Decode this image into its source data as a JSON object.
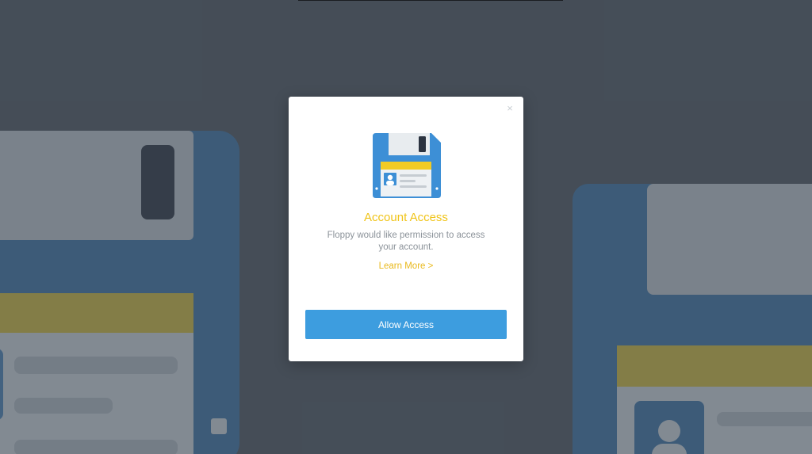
{
  "modal": {
    "title": "Account Access",
    "description": "Floppy would like permission to access your account.",
    "learn_more": "Learn More >",
    "allow_button": "Allow Access",
    "close_icon": "close-icon",
    "illustration_icon": "floppy-disk-icon"
  },
  "colors": {
    "backdrop": "#4e5761",
    "title_yellow": "#f0c419",
    "button_blue": "#3d9ddf",
    "floppy_blue": "#3d8fd6",
    "label_yellow": "#f2cb24"
  }
}
